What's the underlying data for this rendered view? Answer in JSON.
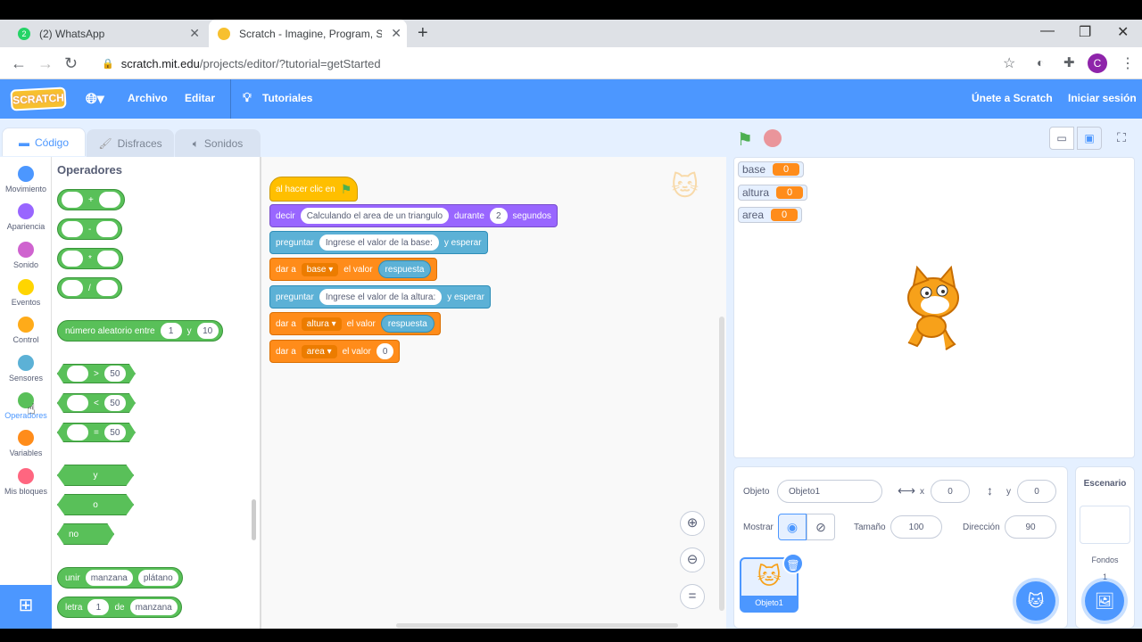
{
  "browser": {
    "tab1": {
      "title": "(2) WhatsApp",
      "badge": "2"
    },
    "tab2": {
      "title": "Scratch - Imagine, Program, Shar"
    },
    "new_tab": "+",
    "url_host": "scratch.mit.edu",
    "url_path": "/projects/editor/?tutorial=getStarted",
    "avatar_letter": "C"
  },
  "menu": {
    "logo": "SCRATCH",
    "file": "Archivo",
    "edit": "Editar",
    "tutorials": "Tutoriales",
    "join": "Únete a Scratch",
    "signin": "Iniciar sesión"
  },
  "tabs": {
    "code": "Código",
    "costumes": "Disfraces",
    "sounds": "Sonidos"
  },
  "categories": [
    {
      "label": "Movimiento",
      "color": "#4c97ff"
    },
    {
      "label": "Apariencia",
      "color": "#9966ff"
    },
    {
      "label": "Sonido",
      "color": "#cf63cf"
    },
    {
      "label": "Eventos",
      "color": "#ffd500"
    },
    {
      "label": "Control",
      "color": "#ffab19"
    },
    {
      "label": "Sensores",
      "color": "#5cb1d6"
    },
    {
      "label": "Operadores",
      "color": "#59c059"
    },
    {
      "label": "Variables",
      "color": "#ff8c1a"
    },
    {
      "label": "Mis bloques",
      "color": "#ff6680"
    }
  ],
  "palette": {
    "title": "Operadores",
    "arith": [
      "+",
      "-",
      "*",
      "/"
    ],
    "random": {
      "label": "número aleatorio entre",
      "a": "1",
      "and": "y",
      "b": "10"
    },
    "compare": [
      {
        "op": ">",
        "v": "50"
      },
      {
        "op": "<",
        "v": "50"
      },
      {
        "op": "=",
        "v": "50"
      }
    ],
    "logic": {
      "and": "y",
      "or": "o",
      "not": "no"
    },
    "join": {
      "label": "unir",
      "a": "manzana",
      "b": "plátano"
    },
    "letter": {
      "label": "letra",
      "n": "1",
      "of": "de",
      "word": "manzana"
    }
  },
  "script": {
    "hat": "al hacer clic en",
    "say": {
      "label": "decir",
      "text": "Calculando el area de un triangulo",
      "for": "durante",
      "secs": "2",
      "unit": "segundos"
    },
    "ask1": {
      "label": "preguntar",
      "text": "Ingrese el valor de la base:",
      "wait": "y esperar"
    },
    "set1": {
      "label": "dar a",
      "var": "base",
      "val_label": "el valor",
      "val": "respuesta"
    },
    "ask2": {
      "label": "preguntar",
      "text": "Ingrese el valor de la altura:",
      "wait": "y esperar"
    },
    "set2": {
      "label": "dar a",
      "var": "altura",
      "val_label": "el valor",
      "val": "respuesta"
    },
    "set3": {
      "label": "dar a",
      "var": "area",
      "val_label": "el valor",
      "val": "0"
    }
  },
  "monitors": [
    {
      "name": "base",
      "value": "0"
    },
    {
      "name": "altura",
      "value": "0"
    },
    {
      "name": "area",
      "value": "0"
    }
  ],
  "sprite": {
    "obj_label": "Objeto",
    "name": "Objeto1",
    "x_label": "x",
    "x": "0",
    "y_label": "y",
    "y": "0",
    "show_label": "Mostrar",
    "size_label": "Tamaño",
    "size": "100",
    "dir_label": "Dirección",
    "dir": "90",
    "thumb_name": "Objeto1"
  },
  "stage_pane": {
    "title": "Escenario",
    "backdrops_label": "Fondos",
    "backdrops_count": "1"
  }
}
